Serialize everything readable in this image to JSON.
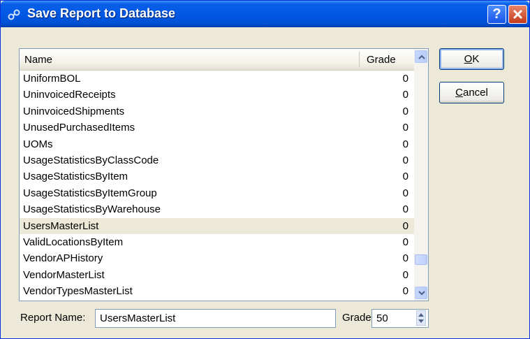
{
  "window": {
    "title": "Save Report to Database",
    "help_label": "?"
  },
  "list": {
    "columns": {
      "name": "Name",
      "grade": "Grade"
    },
    "rows": [
      {
        "name": "UniformBOL",
        "grade": "0"
      },
      {
        "name": "UninvoicedReceipts",
        "grade": "0"
      },
      {
        "name": "UninvoicedShipments",
        "grade": "0"
      },
      {
        "name": "UnusedPurchasedItems",
        "grade": "0"
      },
      {
        "name": "UOMs",
        "grade": "0"
      },
      {
        "name": "UsageStatisticsByClassCode",
        "grade": "0"
      },
      {
        "name": "UsageStatisticsByItem",
        "grade": "0"
      },
      {
        "name": "UsageStatisticsByItemGroup",
        "grade": "0"
      },
      {
        "name": "UsageStatisticsByWarehouse",
        "grade": "0"
      },
      {
        "name": "UsersMasterList",
        "grade": "0"
      },
      {
        "name": "ValidLocationsByItem",
        "grade": "0"
      },
      {
        "name": "VendorAPHistory",
        "grade": "0"
      },
      {
        "name": "VendorMasterList",
        "grade": "0"
      },
      {
        "name": "VendorTypesMasterList",
        "grade": "0"
      }
    ],
    "selected_index": 9
  },
  "buttons": {
    "ok": {
      "mnemonic": "O",
      "rest": "K"
    },
    "cancel": {
      "mnemonic": "C",
      "rest": "ancel"
    }
  },
  "form": {
    "report_name_label": "Report Name:",
    "report_name_value": "UsersMasterList",
    "grade_label": "Grade:",
    "grade_value": "50"
  }
}
